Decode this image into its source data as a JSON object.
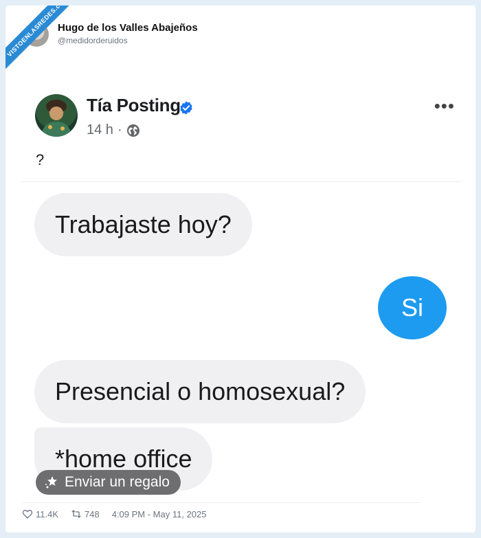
{
  "watermark": {
    "text": "VISTOENLASREDES",
    "sub": ".com"
  },
  "tweet": {
    "author_name": "Hugo de los Valles Abajeños",
    "author_handle": "@medidorderuidos",
    "likes": "11.4K",
    "retweets": "748",
    "timestamp": "4:09 PM - May 11, 2025"
  },
  "post": {
    "author_name": "Tía Posting",
    "time": "14 h",
    "separator": "·",
    "more_label": "•••",
    "text": "?",
    "gift_label": "Enviar un regalo"
  },
  "chat": {
    "messages": [
      {
        "side": "in",
        "text": "Trabajaste hoy?"
      },
      {
        "side": "out",
        "text": "Si"
      },
      {
        "side": "in",
        "text": "Presencial o homosexual?"
      },
      {
        "side": "in",
        "text": "*home office"
      }
    ]
  },
  "colors": {
    "accent": "#1d9bf0",
    "verified": "#1877f2",
    "bubble_in": "#f0f0f2",
    "gift_bg": "#6e6e70",
    "ribbon": "#2a8ad4"
  },
  "icons": [
    "verified-badge-icon",
    "globe-icon",
    "more-icon",
    "gift-icon",
    "heart-icon",
    "retweet-icon"
  ]
}
